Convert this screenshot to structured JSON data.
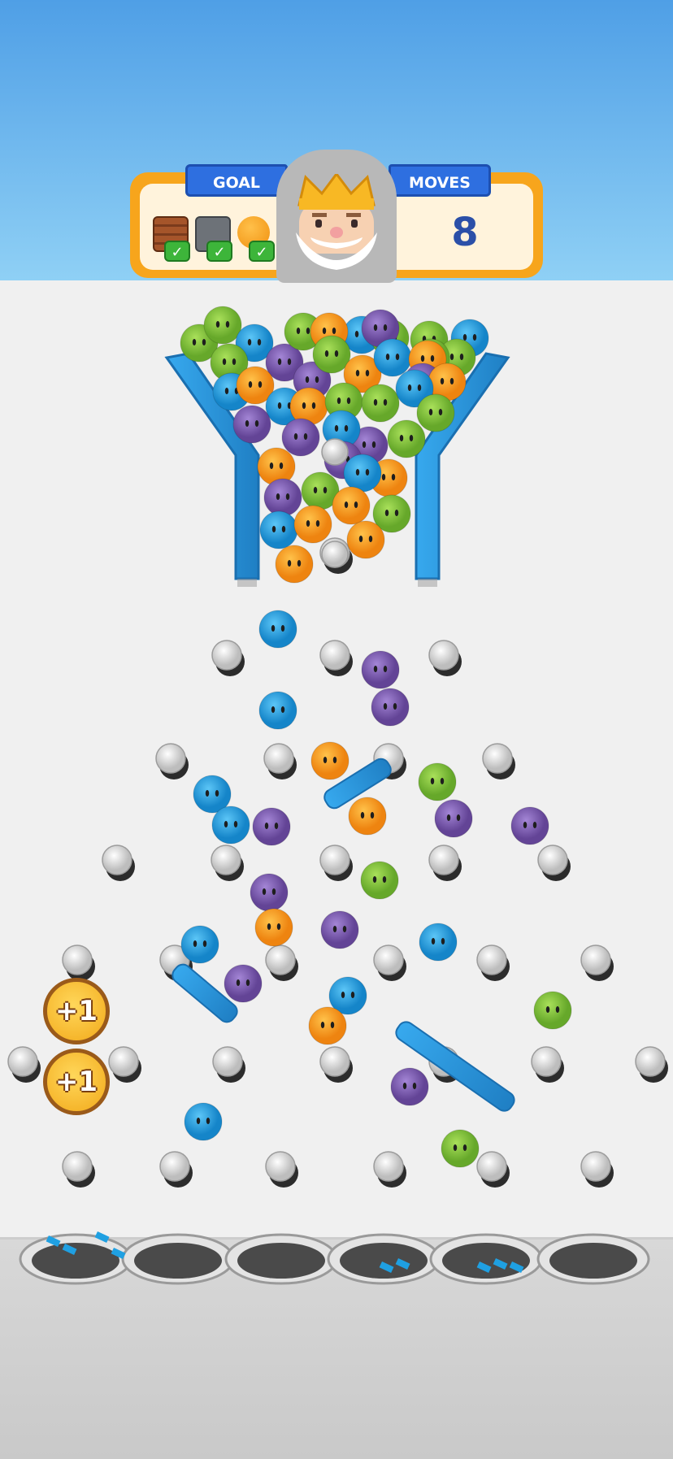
{
  "hud": {
    "goal_label": "GOAL",
    "moves_label": "MOVES",
    "moves_value": "8",
    "goal_items": [
      {
        "icon": "crate-icon",
        "completed": true
      },
      {
        "icon": "stone-block-icon",
        "completed": true
      },
      {
        "icon": "orange-ball-icon",
        "completed": true
      }
    ]
  },
  "bonuses": [
    {
      "label": "+1"
    },
    {
      "label": "+1"
    }
  ],
  "colors": {
    "green": "#7cc23a",
    "blue": "#1fa0e2",
    "orange": "#f7961c",
    "purple": "#7b5bb2",
    "funnel": "#2f9fe4",
    "hud_orange": "#f7a51c",
    "ribbon_blue": "#2e6fe0",
    "check_green": "#3db53a"
  }
}
